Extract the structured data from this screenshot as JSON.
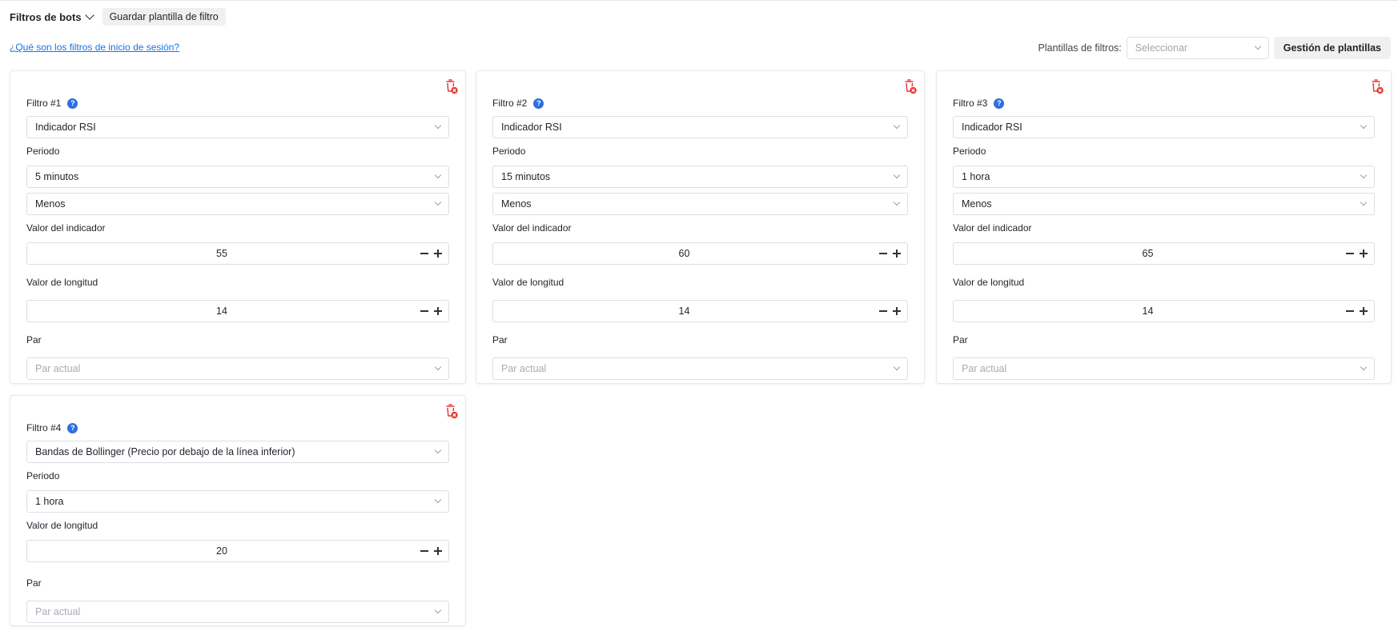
{
  "toolbar": {
    "title": "Filtros de bots",
    "save_template_label": "Guardar plantilla de filtro"
  },
  "help_link": "¿Qué son los filtros de inicio de sesión?",
  "templates": {
    "label": "Plantillas de filtros:",
    "select_placeholder": "Seleccionar",
    "manage_label": "Gestión de plantillas"
  },
  "labels": {
    "period": "Periodo",
    "indicator_value": "Valor del indicador",
    "length_value": "Valor de longitud",
    "pair": "Par",
    "pair_placeholder": "Par actual"
  },
  "filters": [
    {
      "title": "Filtro #1",
      "indicator": "Indicador RSI",
      "period": "5 minutos",
      "condition": "Menos",
      "indicator_value": "55",
      "length_value": "14"
    },
    {
      "title": "Filtro #2",
      "indicator": "Indicador RSI",
      "period": "15 minutos",
      "condition": "Menos",
      "indicator_value": "60",
      "length_value": "14"
    },
    {
      "title": "Filtro #3",
      "indicator": "Indicador RSI",
      "period": "1 hora",
      "condition": "Menos",
      "indicator_value": "65",
      "length_value": "14"
    },
    {
      "title": "Filtro #4",
      "indicator": "Bandas de Bollinger (Precio por debajo de la línea inferior)",
      "period": "1 hora",
      "length_value": "20"
    }
  ],
  "colors": {
    "link": "#1a73e8",
    "help_icon": "#2c6fe0",
    "delete_icon": "#e53935",
    "border": "#dcdfe6"
  }
}
